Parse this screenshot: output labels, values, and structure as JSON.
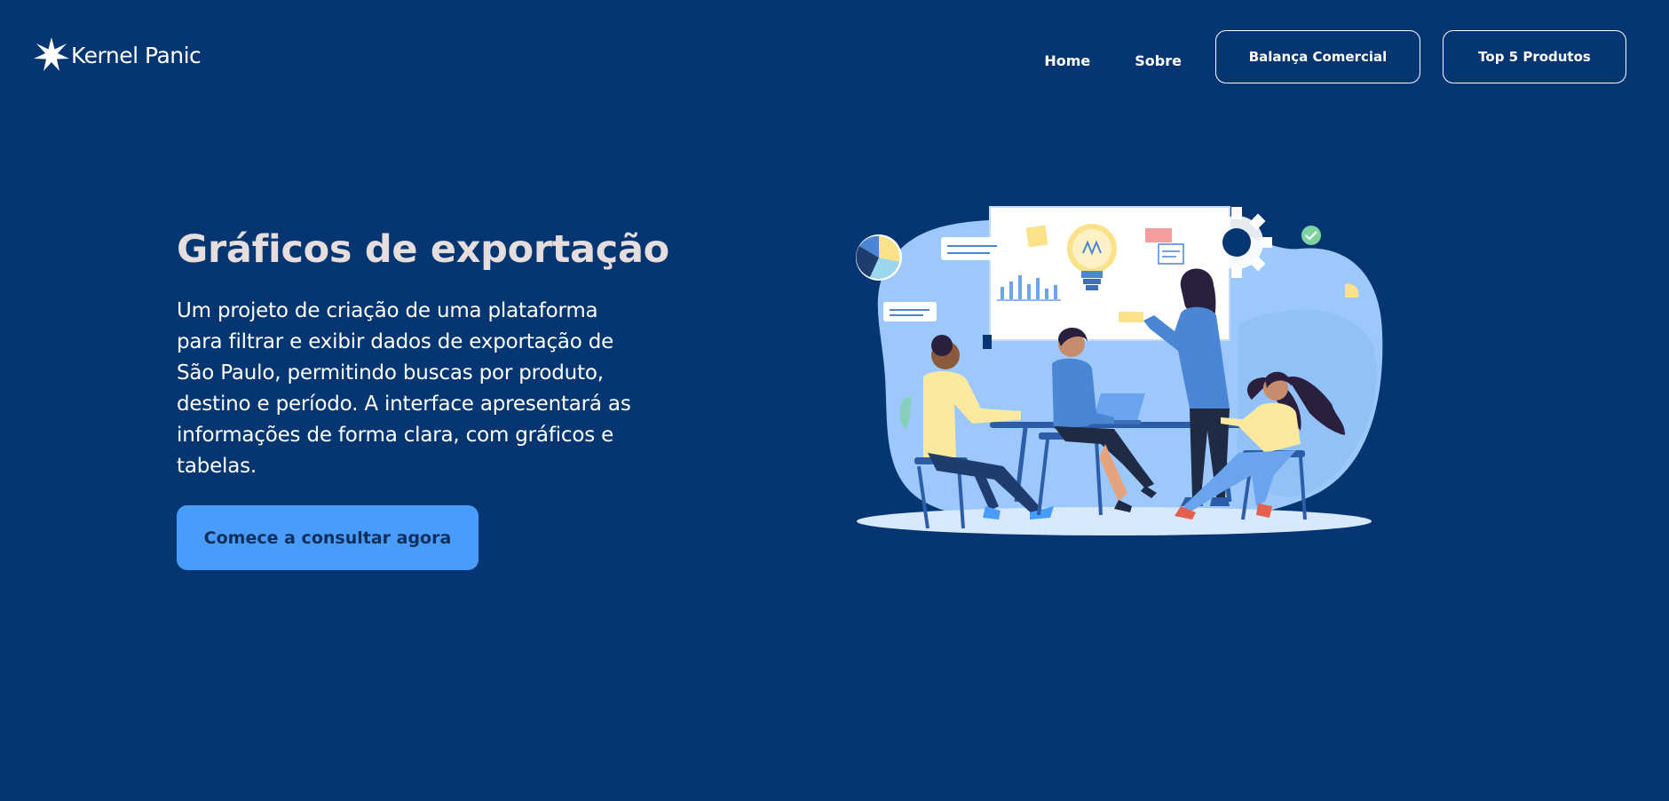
{
  "brand": {
    "name": "Kernel Panic",
    "logo_icon": "star-logo-icon"
  },
  "nav": {
    "home_label": "Home",
    "sobre_label": "Sobre",
    "balanca_label": "Balança Comercial",
    "top5_label": "Top 5 Produtos"
  },
  "hero": {
    "title": "Gráficos de exportação",
    "description": "Um projeto de criação de uma plataforma para filtrar e exibir dados de exportação de São Paulo, permitindo buscas por produto, destino e período. A interface apresentará as informações de forma clara, com gráficos e tabelas.",
    "cta_label": "Comece a consultar agora",
    "illustration": "team-meeting-illustration"
  },
  "colors": {
    "background": "#053672",
    "title": "#e6dede",
    "cta_background": "#4a9cfb",
    "cta_text": "#0d2f5a"
  }
}
